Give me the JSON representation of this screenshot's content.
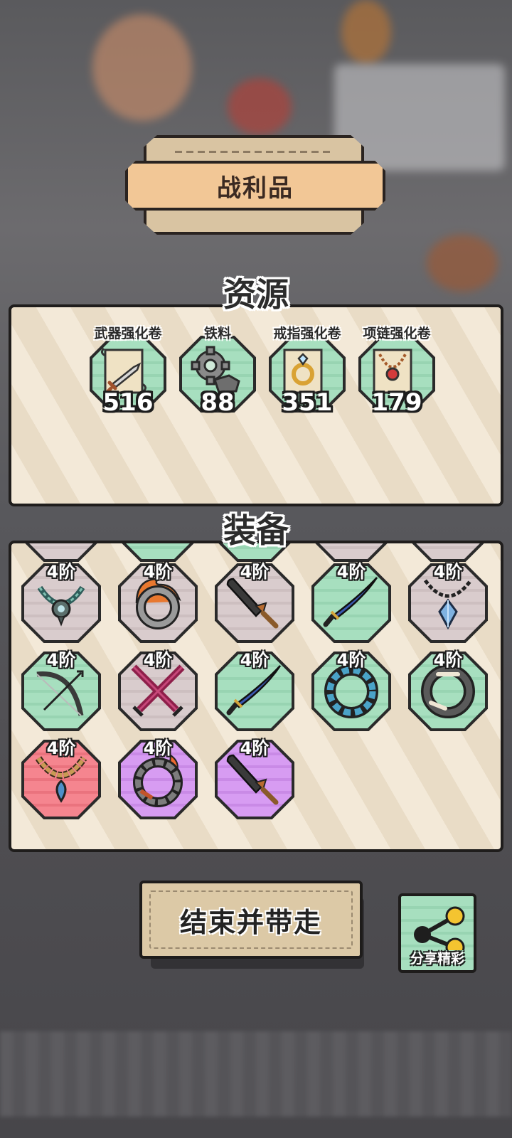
{
  "header": {
    "title": "战利品"
  },
  "resources": {
    "heading": "资源",
    "items": [
      {
        "name": "武器强化卷",
        "count": "516",
        "icon": "weapon-scroll-icon"
      },
      {
        "name": "铁料",
        "count": "88",
        "icon": "iron-gear-icon"
      },
      {
        "name": "戒指强化卷",
        "count": "351",
        "icon": "ring-scroll-icon"
      },
      {
        "name": "项链强化卷",
        "count": "179",
        "icon": "necklace-scroll-icon"
      }
    ]
  },
  "equipment": {
    "heading": "装备",
    "items": [
      {
        "tier": "4阶",
        "rarity": "gray",
        "icon": "ornate-necklace-icon"
      },
      {
        "tier": "4阶",
        "rarity": "gray",
        "icon": "flame-ring-icon"
      },
      {
        "tier": "4阶",
        "rarity": "gray",
        "icon": "broadsword-icon"
      },
      {
        "tier": "4阶",
        "rarity": "green",
        "icon": "katana-icon"
      },
      {
        "tier": "4阶",
        "rarity": "gray",
        "icon": "crystal-pendant-icon"
      },
      {
        "tier": "4阶",
        "rarity": "green",
        "icon": "bow-icon"
      },
      {
        "tier": "4阶",
        "rarity": "gray",
        "icon": "crossed-swords-icon"
      },
      {
        "tier": "4阶",
        "rarity": "green",
        "icon": "katana-icon"
      },
      {
        "tier": "4阶",
        "rarity": "green",
        "icon": "water-ring-icon"
      },
      {
        "tier": "4阶",
        "rarity": "green",
        "icon": "bone-ring-icon"
      },
      {
        "tier": "4阶",
        "rarity": "red",
        "icon": "bead-necklace-icon"
      },
      {
        "tier": "4阶",
        "rarity": "purple",
        "icon": "fire-bracelet-icon"
      },
      {
        "tier": "4阶",
        "rarity": "purple",
        "icon": "broadsword-icon"
      }
    ]
  },
  "actions": {
    "finish_label": "结束并带走",
    "share_label": "分享精彩"
  },
  "colors": {
    "green_rarity": "#a7dfbf",
    "gray_rarity": "#d9cccd",
    "red_rarity": "#f5858f",
    "purple_rarity": "#d79cf2",
    "banner": "#f2c796"
  }
}
